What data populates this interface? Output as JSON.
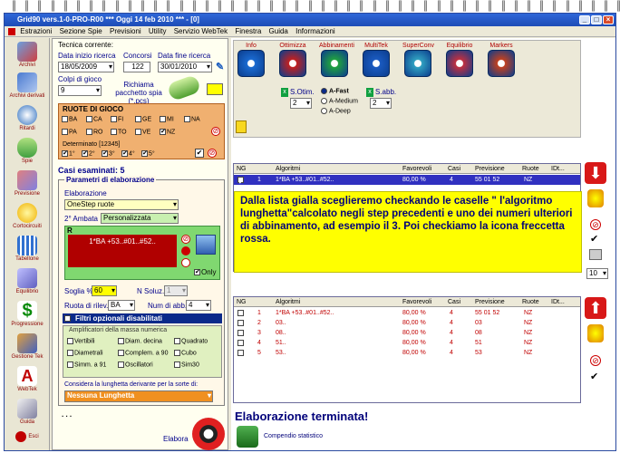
{
  "window_title": "Grid90 vers.1-0-PRO-R00  ***  Oggi 14 feb 2010  ***  - [0]",
  "menu": [
    "Estrazioni",
    "Sezione Spie",
    "Previsioni",
    "Utility",
    "Servizio WebTek",
    "Finestra",
    "Guida",
    "Informazioni"
  ],
  "left_tools": [
    "Archivi",
    "Archivi derivati",
    "Ritardi",
    "Spie",
    "Previsione",
    "Cortocircuiti",
    "Tabellone",
    "Equilibrio",
    "Progressione",
    "Gestione Tek",
    "WebTek",
    "Guida",
    "Esci"
  ],
  "left_panel": {
    "tecnica_label": "Tecnica corrente:",
    "data_inizio_label": "Data inizio ricerca",
    "data_inizio_value": "18/05/2009",
    "concorsi_label": "Concorsi",
    "concorsi_value": "122",
    "data_fine_label": "Data fine ricerca",
    "data_fine_value": "30/01/2010",
    "colpi_label": "Colpi di gioco",
    "colpi_value": "9",
    "richiama_label": "Richiama pacchetto spia (*.pcs)",
    "ruote_title": "RUOTE DI GIOCO",
    "ruote": [
      "BA",
      "CA",
      "FI",
      "GE",
      "MI",
      "NA",
      "PA",
      "RO",
      "TO",
      "VE",
      "NZ"
    ],
    "determinato_label": "Determinato [12345]",
    "determinato": [
      "1°",
      "2°",
      "3°",
      "4°",
      "5°"
    ],
    "casi_label": "Casi esaminati: 5",
    "parametri_title": "Parametri di elaborazione",
    "elaborazione_label": "Elaborazione",
    "elaborazione_value": "OneStep ruote",
    "ambata_label": "2° Ambata",
    "ambata_value": "Personalizzata",
    "r_label": "R",
    "r_value": "1*BA +53..#01..#52..",
    "only_label": "Only",
    "soglia_label": "Soglia %",
    "soglia_value": "60",
    "nsoluz_label": "N Soluz.",
    "nsoluz_value": "1",
    "ruota_rilev_label": "Ruota di rilev.",
    "ruota_rilev_value": "BA",
    "num_abb_label": "Num di abb.",
    "num_abb_value": "4",
    "filtri_label": "Filtri opzionali disabilitati",
    "amplificatori_label": "Amplificatori della massa numerica",
    "filtri": [
      "Vertibili",
      "Diam. decina",
      "Quadrato",
      "Diametrali",
      "Complem. a 90",
      "Cubo",
      "Simm. a 91",
      "Oscillatori",
      "Sim30"
    ],
    "considera_label": "Considera la lunghetta derivante per la sorte di:",
    "lunghetta_value": "Nessuna Lunghetta",
    "dots": ". . .",
    "elabora_label": "Elabora"
  },
  "top_tools": [
    "Info",
    "Ottimizza",
    "Abbinamenti",
    "MultiTek",
    "SuperConv",
    "Equilibrio",
    "Markers"
  ],
  "options": {
    "s_otim_label": "S.Otim.",
    "s_otim_value": "2",
    "s_abb_label": "S.abb.",
    "s_abb_value": "2",
    "modes": [
      "A-Fast",
      "A-Medium",
      "A-Deep"
    ]
  },
  "table_headers": [
    "NG",
    "Algoritmi",
    "Favorevoli",
    "Casi",
    "Previsione",
    "Ruote",
    "IDt..."
  ],
  "top_table_rows": [
    {
      "ng": "1",
      "alg": "1*BA +53..#01..#52..",
      "fav": "80,00 %",
      "casi": "4",
      "prev": "55 01 52",
      "ruote": "NZ"
    }
  ],
  "info_text": "Dalla lista gialla sceglieremo checkando le caselle \" l'algoritmo lunghetta\"calcolato negli step precedenti e uno dei numeri ulteriori di abbinamento, ad esempio il 3. Poi checkiamo la icona freccetta rossa.",
  "bottom_table_rows": [
    {
      "ng": "1",
      "alg": "1*BA +53..#01..#52..",
      "fav": "80,00 %",
      "casi": "4",
      "prev": "55 01 52",
      "ruote": "NZ"
    },
    {
      "ng": "2",
      "alg": "03..",
      "fav": "80,00 %",
      "casi": "4",
      "prev": "03",
      "ruote": "NZ"
    },
    {
      "ng": "3",
      "alg": "08..",
      "fav": "80,00 %",
      "casi": "4",
      "prev": "08",
      "ruote": "NZ"
    },
    {
      "ng": "4",
      "alg": "51..",
      "fav": "80,00 %",
      "casi": "4",
      "prev": "51",
      "ruote": "NZ"
    },
    {
      "ng": "5",
      "alg": "53..",
      "fav": "80,00 %",
      "casi": "4",
      "prev": "53",
      "ruote": "NZ"
    }
  ],
  "status_text": "Elaborazione terminata!",
  "compendio_label": "Compendio statistico",
  "side_combo_value": "10",
  "colors": {
    "title_bar": "#1d4cb6",
    "accent_red": "#c00000",
    "highlight_yellow": "#ffff00",
    "panel_green": "#c8f0b0",
    "panel_orange": "#f0b070"
  }
}
